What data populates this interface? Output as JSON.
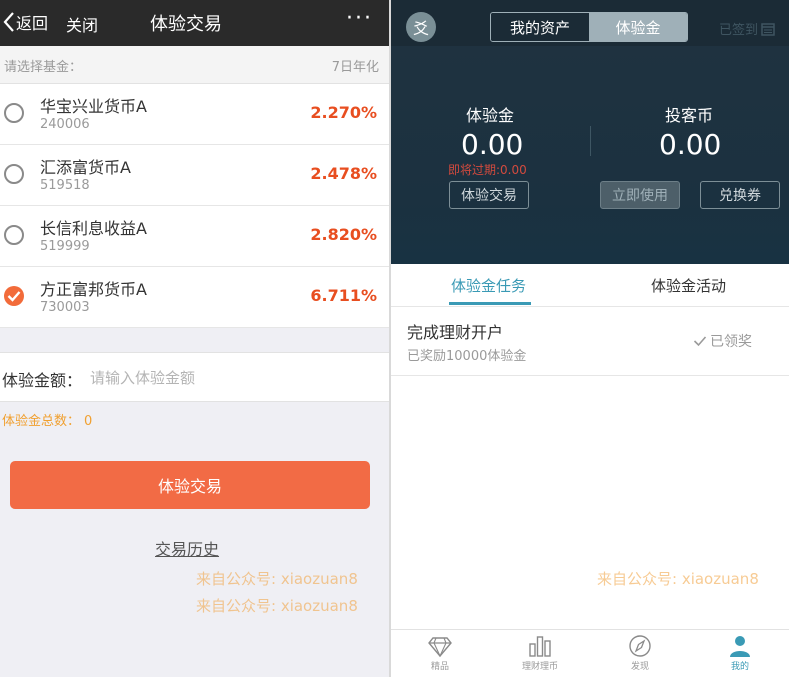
{
  "left": {
    "header": {
      "back_label": "返回",
      "close_label": "关闭",
      "title": "体验交易",
      "more_label": "···"
    },
    "fund_header": {
      "left": "请选择基金：",
      "right": "7日年化"
    },
    "funds": [
      {
        "name": "华宝兴业货币A",
        "code": "240006",
        "rate": "2.270%",
        "selected": false
      },
      {
        "name": "汇添富货币A",
        "code": "519518",
        "rate": "2.478%",
        "selected": false
      },
      {
        "name": "长信利息收益A",
        "code": "519999",
        "rate": "2.820%",
        "selected": false
      },
      {
        "name": "方正富邦货币A",
        "code": "730003",
        "rate": "6.711%",
        "selected": true
      }
    ],
    "amount": {
      "label": "体验金额：",
      "placeholder": "请输入体验金额",
      "value": ""
    },
    "total": {
      "label": "体验金总数：",
      "value": "0"
    },
    "trade_button": "体验交易",
    "history_link": "交易历史",
    "watermark": "来自公众号: xiaozuan8"
  },
  "right": {
    "avatar_char": "爻",
    "segments": {
      "assets": "我的资产",
      "exp": "体验金",
      "active": "exp"
    },
    "signed": "已签到",
    "exp_col": {
      "label": "体验金",
      "value": "0.00",
      "expire": "即将过期:0.00",
      "button": "体验交易"
    },
    "coin_col": {
      "label": "投客币",
      "value": "0.00",
      "use_button": "立即使用",
      "voucher_button": "兑换券"
    },
    "tabs": {
      "task": "体验金任务",
      "activity": "体验金活动"
    },
    "task": {
      "title": "完成理财开户",
      "sub": "已奖励10000体验金",
      "status": "已领奖"
    },
    "watermark": "来自公众号: xiaozuan8",
    "nav": [
      {
        "label": "精品",
        "icon": "diamond-icon"
      },
      {
        "label": "理财理币",
        "icon": "bars-icon"
      },
      {
        "label": "发现",
        "icon": "compass-icon"
      },
      {
        "label": "我的",
        "icon": "user-icon",
        "active": true
      }
    ],
    "colors": {
      "accent": "#3a9ab5",
      "orange": "#f26b45",
      "header_dark": "#1b2b36"
    }
  }
}
